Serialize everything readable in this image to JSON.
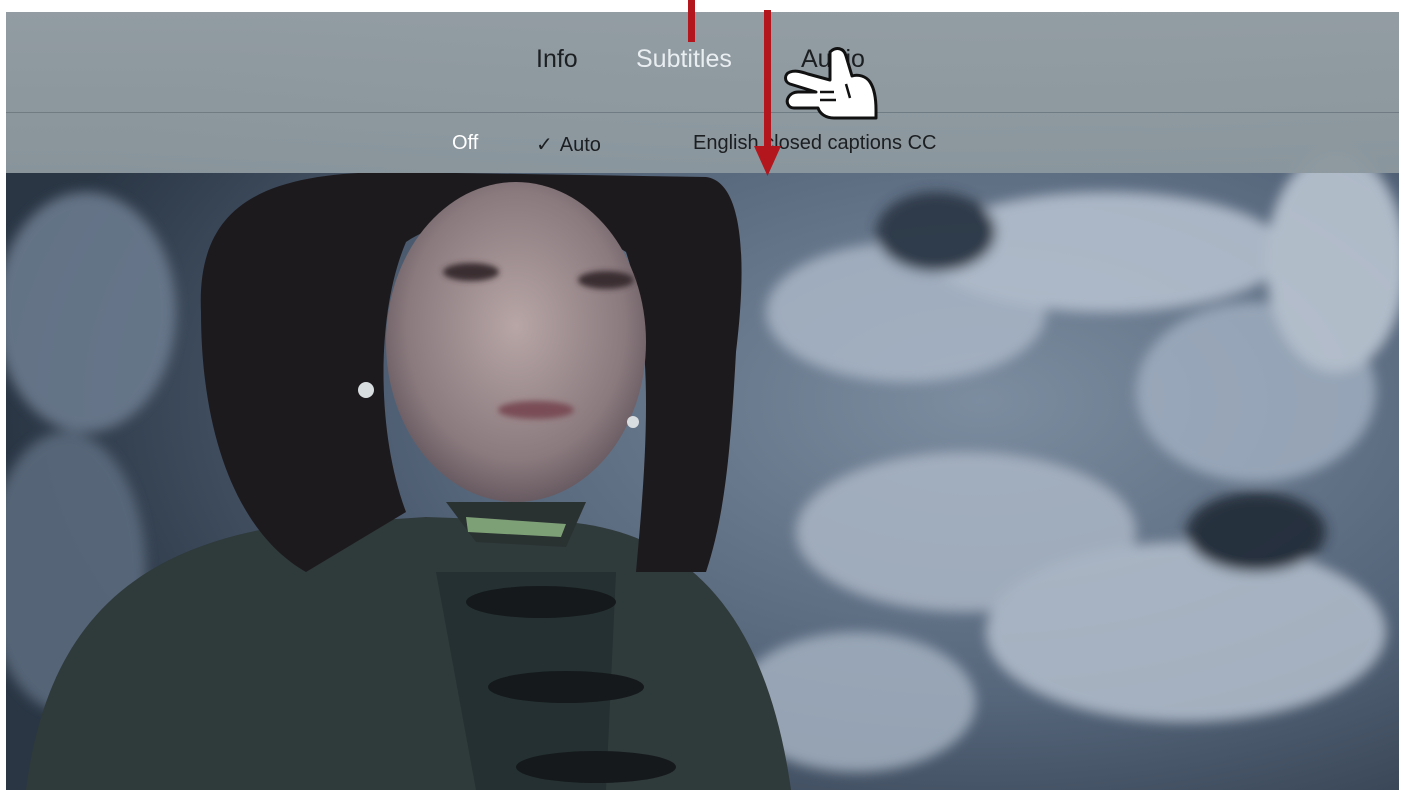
{
  "tabs": [
    {
      "label": "Info"
    },
    {
      "label": "Subtitles"
    },
    {
      "label": "Audio"
    }
  ],
  "subtitle_options": [
    {
      "label": "Off"
    },
    {
      "label": "Auto",
      "check": "✓"
    },
    {
      "label": "English closed captions CC"
    }
  ],
  "colors": {
    "annotation_arrow": "#b3161d",
    "active_tab_text": "#e9eef1",
    "inactive_text": "#1c1f22"
  },
  "icons": {
    "pointer": "pointing-hand-icon",
    "arrow": "down-arrow-icon"
  }
}
